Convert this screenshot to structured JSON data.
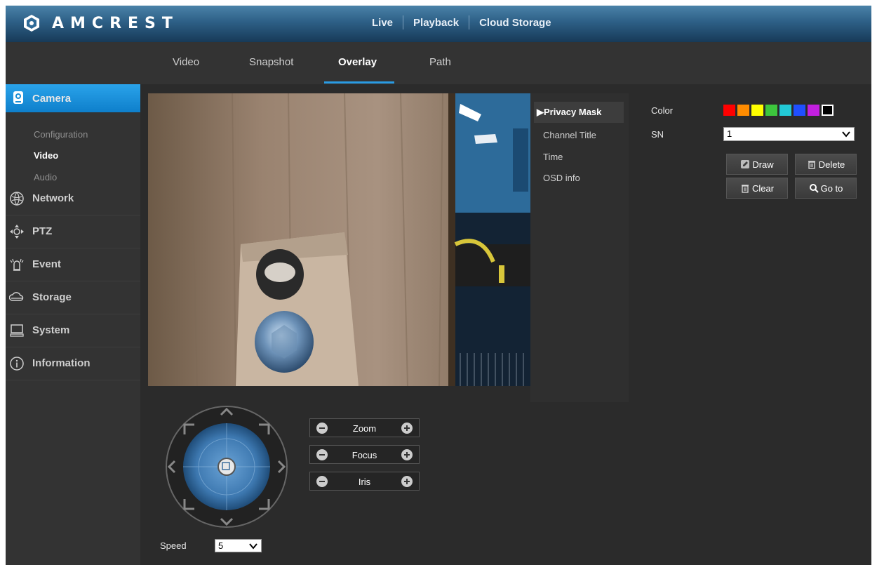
{
  "brand": {
    "name": "AMCREST"
  },
  "topnav": {
    "items": [
      "Live",
      "Playback",
      "Cloud Storage"
    ]
  },
  "subnav": {
    "tabs": [
      "Video",
      "Snapshot",
      "Overlay",
      "Path"
    ],
    "active": "Overlay"
  },
  "sidebar": {
    "active_section": "Camera",
    "camera_subitems": [
      "Configuration",
      "Video",
      "Audio"
    ],
    "active_subitem": "Video",
    "sections": [
      {
        "label": "Network",
        "icon": "network-icon"
      },
      {
        "label": "PTZ",
        "icon": "ptz-icon"
      },
      {
        "label": "Event",
        "icon": "event-icon"
      },
      {
        "label": "Storage",
        "icon": "storage-icon"
      },
      {
        "label": "System",
        "icon": "system-icon"
      },
      {
        "label": "Information",
        "icon": "information-icon"
      }
    ]
  },
  "overlay_menu": {
    "items": [
      "Privacy Mask",
      "Channel Title",
      "Time",
      "OSD info"
    ],
    "active": "Privacy Mask"
  },
  "privacy_mask": {
    "color_label": "Color",
    "colors": [
      "#ff0000",
      "#ff8c00",
      "#ffff00",
      "#3dc63d",
      "#22c9d6",
      "#1f4fff",
      "#c21fe0",
      "#000000"
    ],
    "selected_color": "#000000",
    "sn_label": "SN",
    "sn_value": "1",
    "buttons": {
      "draw": "Draw",
      "delete": "Delete",
      "clear": "Clear",
      "goto": "Go to"
    }
  },
  "ptz": {
    "controls": [
      "Zoom",
      "Focus",
      "Iris"
    ],
    "speed_label": "Speed",
    "speed_value": "5"
  }
}
